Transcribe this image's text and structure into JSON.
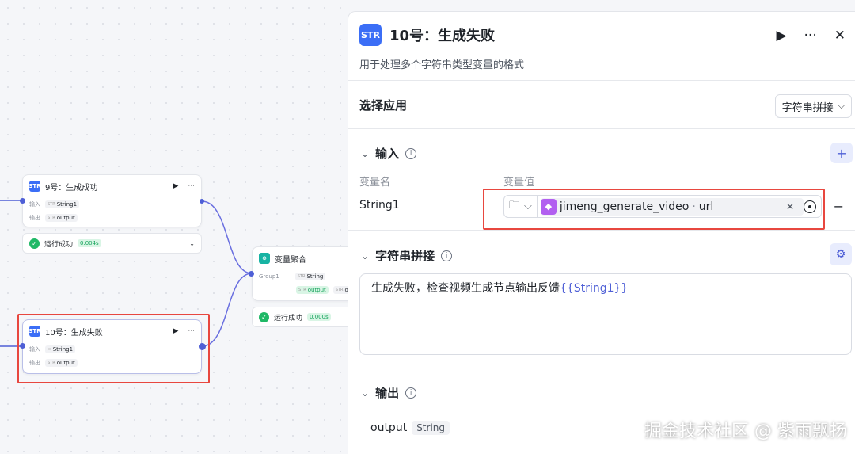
{
  "canvas": {
    "node9": {
      "title": "9号：生成成功",
      "input_label": "输入",
      "output_label": "输出",
      "input_var": "String1",
      "output_var": "output",
      "run_status": "运行成功",
      "run_time": "0.004s"
    },
    "node10": {
      "title": "10号：生成失败",
      "input_label": "输入",
      "output_label": "输出",
      "input_var": "String1",
      "output_var": "output"
    },
    "agg": {
      "title": "变量聚合",
      "group": "Group1",
      "type": "String",
      "output_var": "output",
      "output_var2": "ou",
      "run_status": "运行成功",
      "run_time": "0.000s"
    }
  },
  "panel": {
    "title": "10号：生成失败",
    "description": "用于处理多个字符串类型变量的格式",
    "app_label": "选择应用",
    "app_value": "字符串拼接",
    "input_section": "输入",
    "col_name": "变量名",
    "col_value": "变量值",
    "var_name": "String1",
    "ref_node": "jimeng_generate_video",
    "ref_sep": " · ",
    "ref_field": "url",
    "concat_section": "字符串拼接",
    "template_text": "生成失败，检查视频生成节点输出反馈",
    "template_var": "{{String1}}",
    "output_section": "输出",
    "output_name": "output",
    "output_type": "String"
  },
  "watermark": "掘金技术社区 @ 紫雨飘扬",
  "icons": {
    "node": "str-icon",
    "run": "play-icon",
    "more": "more-icon",
    "close": "close-icon",
    "info": "info-icon",
    "add": "plus-icon",
    "settings": "gear-icon",
    "folder": "folder-icon",
    "target": "target-icon"
  },
  "colors": {
    "accent": "#4e5fd6",
    "highlight": "#e8473f",
    "success": "#1fb866"
  }
}
